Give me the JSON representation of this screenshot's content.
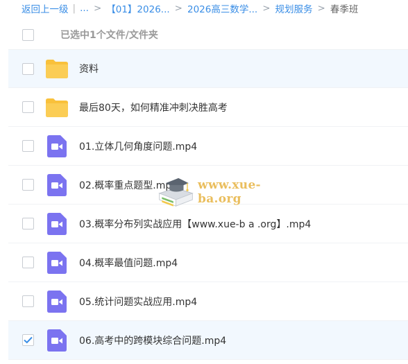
{
  "breadcrumb": {
    "back": "返回上一级",
    "sep_bar": "|",
    "ellipsis": "...",
    "sep": ">",
    "items": [
      "【01】2026...",
      "2026高三数学...",
      "规划服务"
    ],
    "current": "春季班"
  },
  "header": {
    "selection_status": "已选中1个文件/文件夹"
  },
  "files": [
    {
      "name": "资料",
      "type": "folder",
      "checked": false
    },
    {
      "name": "最后80天，如何精准冲刺决胜高考",
      "type": "folder",
      "checked": false
    },
    {
      "name": "01.立体几何角度问题.mp4",
      "type": "video",
      "checked": false
    },
    {
      "name": "02.概率重点题型.mp4",
      "type": "video",
      "checked": false
    },
    {
      "name": "03.概率分布列实战应用【www.xue-b a .org】.mp4",
      "type": "video",
      "checked": false
    },
    {
      "name": "04.概率最值问题.mp4",
      "type": "video",
      "checked": false
    },
    {
      "name": "05.统计问题实战应用.mp4",
      "type": "video",
      "checked": false
    },
    {
      "name": "06.高考中的跨模块综合问题.mp4",
      "type": "video",
      "checked": true
    }
  ],
  "watermark": {
    "text": "www.xue-ba.org"
  },
  "colors": {
    "link": "#3a8ee6",
    "folder": "#f9c13b",
    "video": "#7b73f0",
    "check": "#3a8ee6",
    "row_highlight": "#f2f8fe"
  }
}
